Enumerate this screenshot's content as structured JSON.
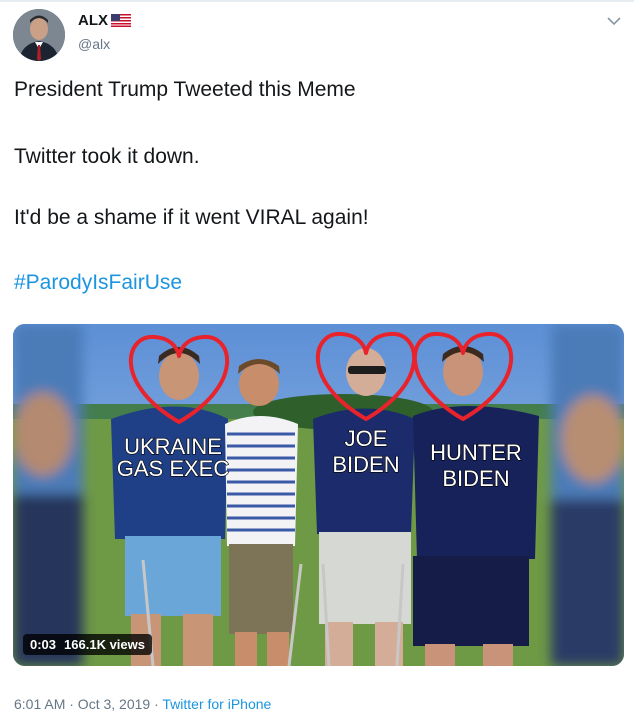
{
  "tweet": {
    "author": {
      "name": "ALX",
      "handle": "@alx",
      "flag_icon": "us-flag-icon"
    },
    "lines": [
      "President Trump Tweeted this Meme",
      "Twitter took it down.",
      "It'd be a shame if it went VIRAL again!"
    ],
    "hashtag": "#ParodyIsFairUse",
    "media": {
      "labels": {
        "person1": [
          "UKRAINE",
          "GAS EXEC"
        ],
        "person3": [
          "JOE",
          "BIDEN"
        ],
        "person4": [
          "HUNTER",
          "BIDEN"
        ]
      },
      "duration": "0:03",
      "views": "166.1K views"
    },
    "timestamp": "6:01 AM · Oct 3, 2019",
    "separator": " · ",
    "source": "Twitter for iPhone"
  },
  "colors": {
    "link": "#1b95e0",
    "secondary_text": "#657786",
    "heart": "#e8232c"
  }
}
